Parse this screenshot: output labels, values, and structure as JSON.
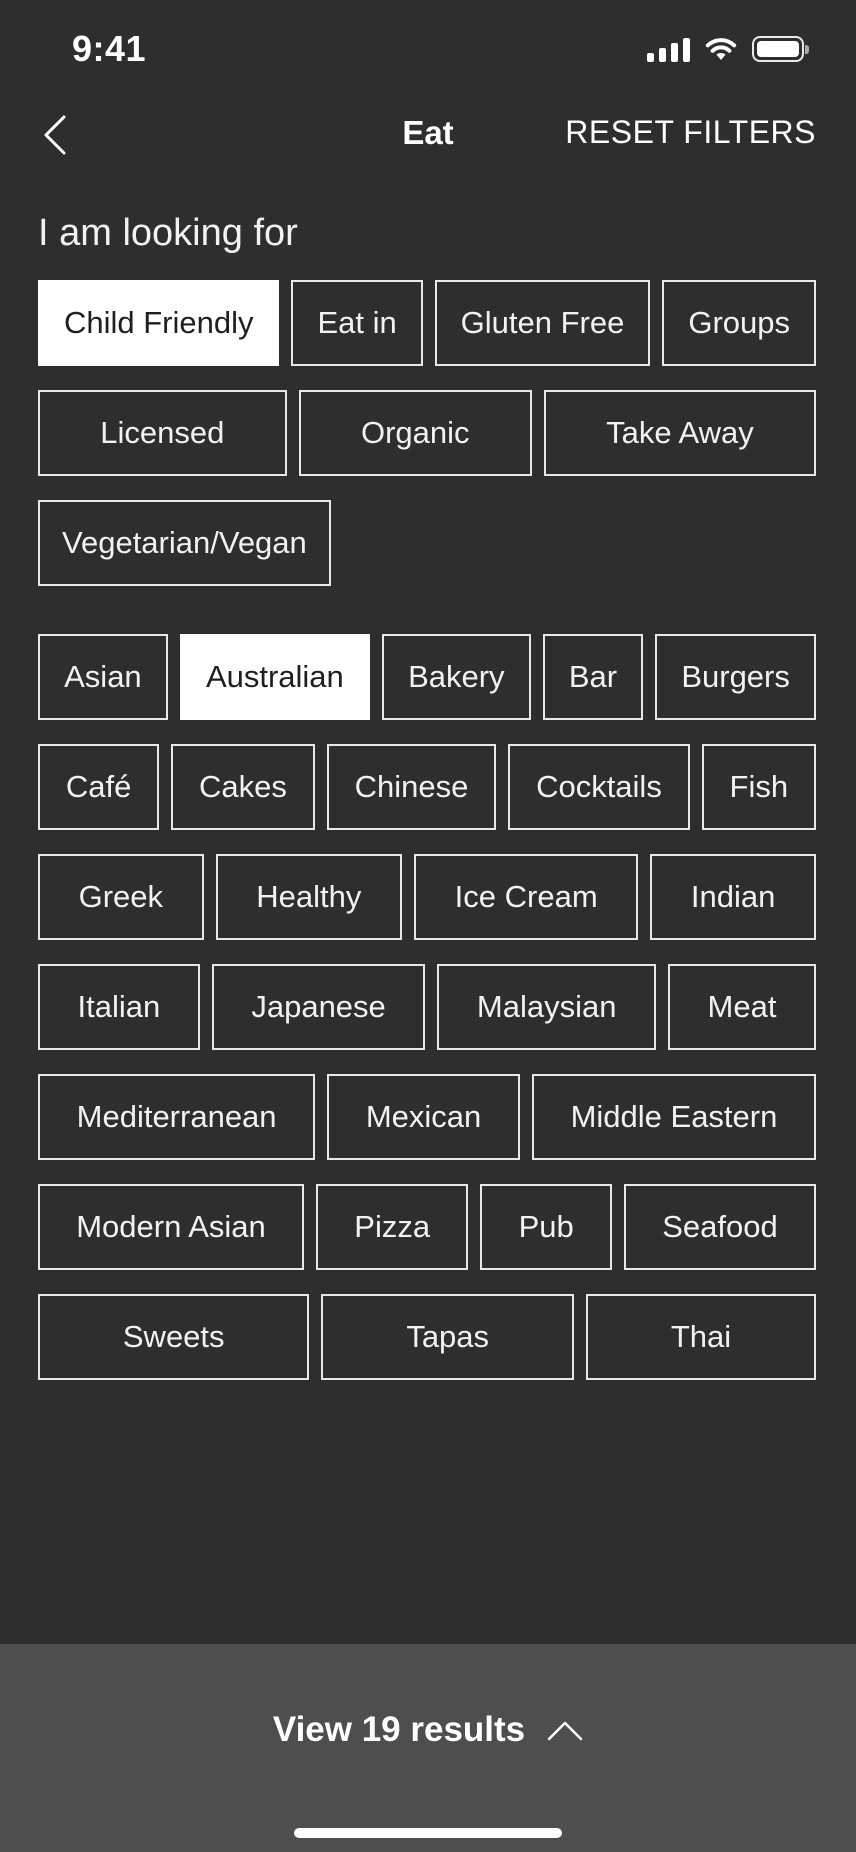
{
  "status_bar": {
    "time": "9:41"
  },
  "nav": {
    "title": "Eat",
    "reset_label": "RESET FILTERS"
  },
  "filters": {
    "heading": "I am looking for"
  },
  "features": [
    {
      "label": "Child Friendly",
      "selected": true
    },
    {
      "label": "Eat in",
      "selected": false
    },
    {
      "label": "Gluten Free",
      "selected": false
    },
    {
      "label": "Groups",
      "selected": false
    },
    {
      "label": "Licensed",
      "selected": false
    },
    {
      "label": "Organic",
      "selected": false
    },
    {
      "label": "Take Away",
      "selected": false
    },
    {
      "label": "Vegetarian/Vegan",
      "selected": false
    }
  ],
  "cuisines": [
    {
      "label": "Asian",
      "selected": false
    },
    {
      "label": "Australian",
      "selected": true
    },
    {
      "label": "Bakery",
      "selected": false
    },
    {
      "label": "Bar",
      "selected": false
    },
    {
      "label": "Burgers",
      "selected": false
    },
    {
      "label": "Café",
      "selected": false
    },
    {
      "label": "Cakes",
      "selected": false
    },
    {
      "label": "Chinese",
      "selected": false
    },
    {
      "label": "Cocktails",
      "selected": false
    },
    {
      "label": "Fish",
      "selected": false
    },
    {
      "label": "Greek",
      "selected": false
    },
    {
      "label": "Healthy",
      "selected": false
    },
    {
      "label": "Ice Cream",
      "selected": false
    },
    {
      "label": "Indian",
      "selected": false
    },
    {
      "label": "Italian",
      "selected": false
    },
    {
      "label": "Japanese",
      "selected": false
    },
    {
      "label": "Malaysian",
      "selected": false
    },
    {
      "label": "Meat",
      "selected": false
    },
    {
      "label": "Mediterranean",
      "selected": false
    },
    {
      "label": "Mexican",
      "selected": false
    },
    {
      "label": "Middle Eastern",
      "selected": false
    },
    {
      "label": "Modern Asian",
      "selected": false
    },
    {
      "label": "Pizza",
      "selected": false
    },
    {
      "label": "Pub",
      "selected": false
    },
    {
      "label": "Seafood",
      "selected": false
    },
    {
      "label": "Sweets",
      "selected": false
    },
    {
      "label": "Tapas",
      "selected": false
    },
    {
      "label": "Thai",
      "selected": false
    }
  ],
  "results": {
    "label": "View 19 results"
  },
  "icons": {
    "back": "chevron-left-icon",
    "expand": "chevron-up-icon",
    "signal": "cellular-signal-icon",
    "wifi": "wifi-icon",
    "battery": "battery-icon"
  },
  "colors": {
    "background": "#2e2e30",
    "chip_border": "#e8e8e8",
    "chip_selected_bg": "#ffffff",
    "results_bar": "#4e4e50"
  }
}
